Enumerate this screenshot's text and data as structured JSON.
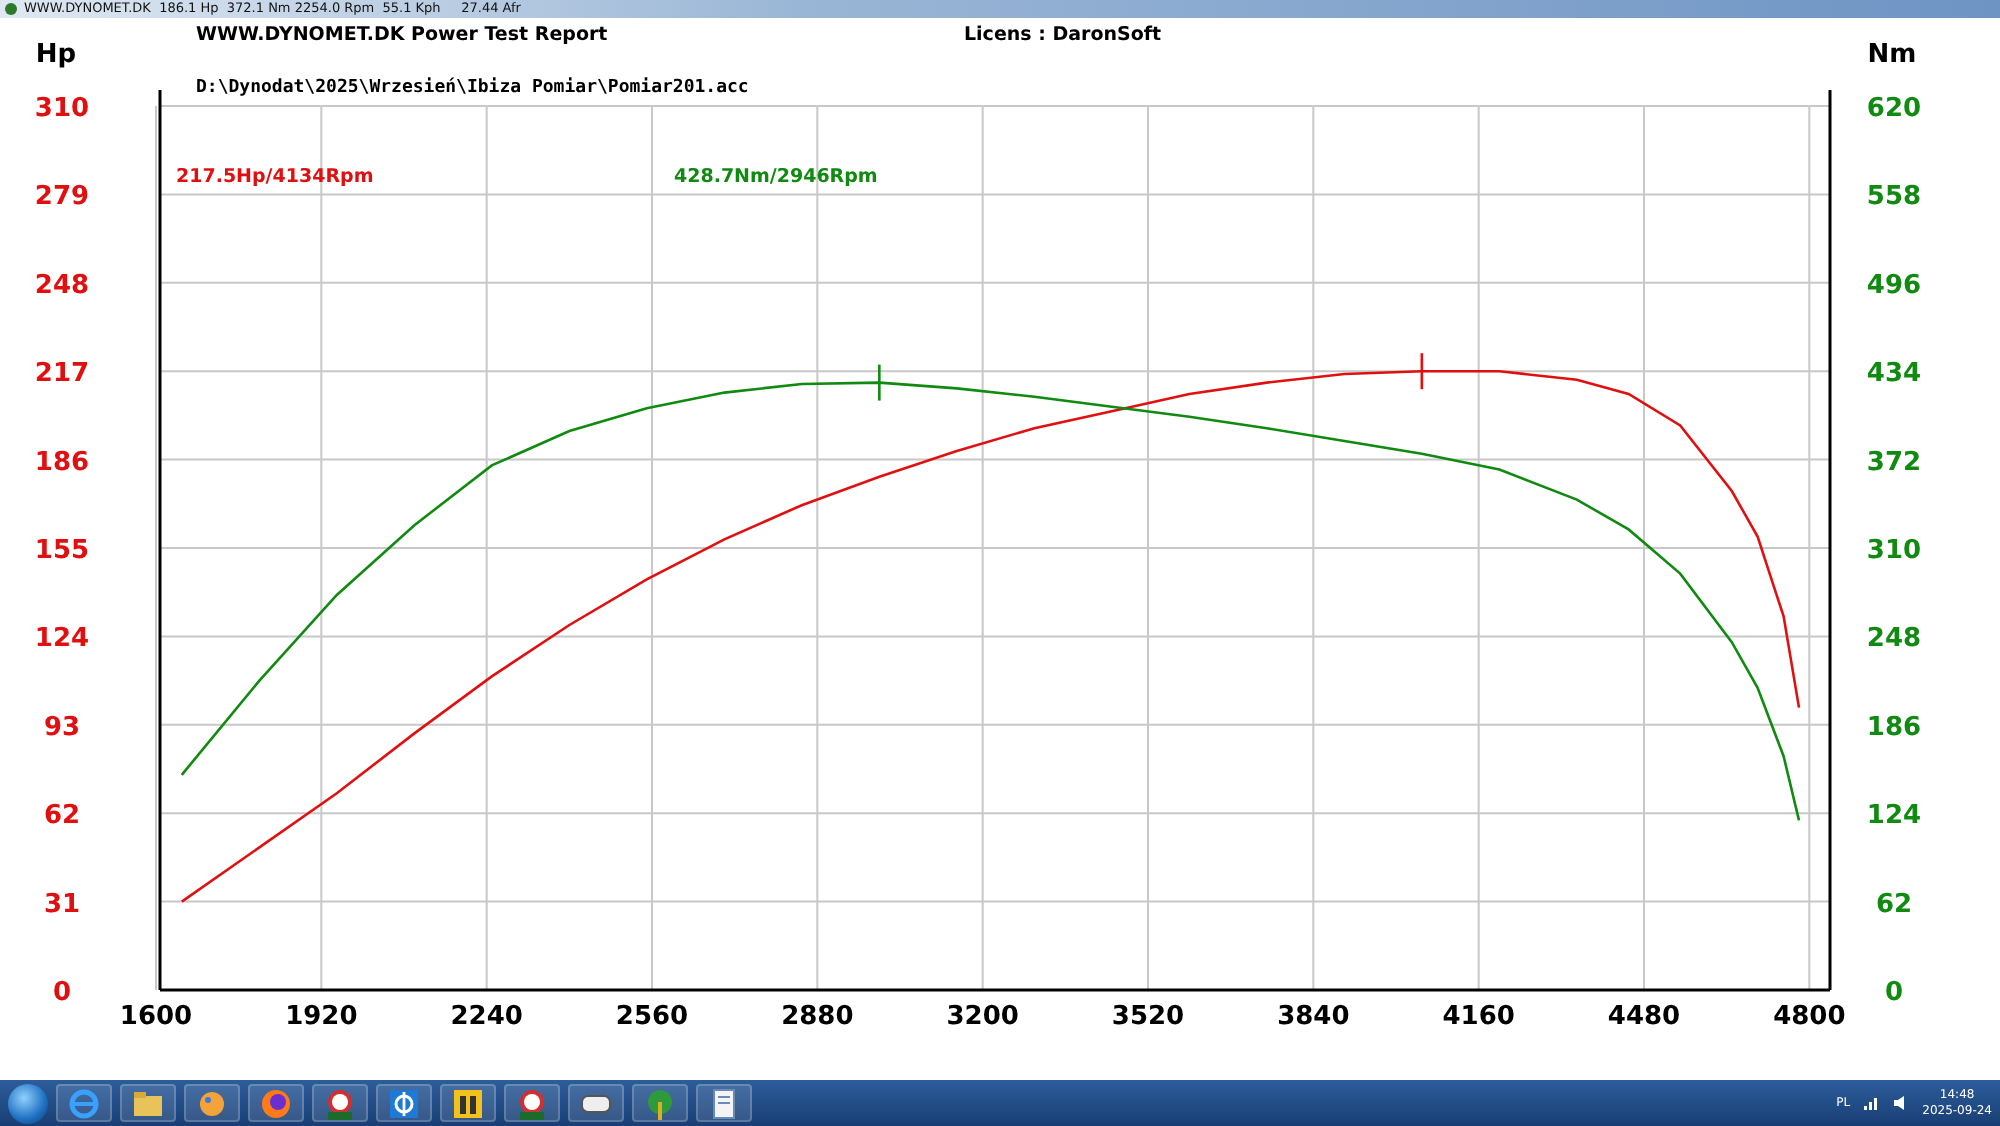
{
  "window": {
    "title": "WWW.DYNOMET.DK  186.1 Hp  372.1 Nm 2254.0 Rpm  55.1 Kph     27.44 Afr"
  },
  "report": {
    "header": "WWW.DYNOMET.DK  Power Test Report",
    "licence": "Licens :  DaronSoft",
    "file": "D:\\Dynodat\\2025\\Wrzesień\\Ibiza Pomiar\\Pomiar201.acc",
    "chart_data": {
      "type": "line",
      "ylabel": "Hp",
      "y2label": "Nm",
      "grid": true,
      "xlim": [
        1600,
        4840
      ],
      "ylim": [
        0,
        310
      ],
      "y2lim": [
        0,
        620
      ],
      "xticks": [
        1600,
        1920,
        2240,
        2560,
        2880,
        3200,
        3520,
        3840,
        4160,
        4480,
        4800
      ],
      "yticks": [
        0,
        31,
        62,
        93,
        124,
        155,
        186,
        217,
        248,
        279,
        310
      ],
      "y2ticks": [
        0,
        62,
        124,
        186,
        248,
        310,
        372,
        434,
        496,
        558,
        620
      ],
      "x": [
        1650,
        1800,
        1950,
        2100,
        2250,
        2400,
        2550,
        2700,
        2850,
        3000,
        3150,
        3300,
        3450,
        3600,
        3750,
        3900,
        4050,
        4200,
        4350,
        4450,
        4550,
        4650,
        4700,
        4750,
        4780
      ],
      "series": [
        {
          "color": "#e01010",
          "values": [
            31,
            50,
            69,
            90,
            110,
            128,
            144,
            158,
            170,
            180,
            189,
            197,
            203,
            209,
            213,
            216,
            217,
            217,
            214,
            209,
            198,
            175,
            159,
            131,
            99
          ]
        },
        {
          "axis": "y2",
          "color": "#108a10",
          "values": [
            151,
            217,
            277,
            326,
            368,
            392,
            408,
            419,
            425,
            426,
            422,
            416,
            409,
            402,
            394,
            385,
            376,
            365,
            344,
            323,
            292,
            244,
            212,
            164,
            119
          ]
        }
      ],
      "annotations": [
        "217.5Hp/4134Rpm",
        "428.7Nm/2946Rpm"
      ]
    }
  },
  "taskbar": {
    "apps": [
      {
        "kind": "ie"
      },
      {
        "kind": "folder"
      },
      {
        "kind": "paint"
      },
      {
        "kind": "firefox"
      },
      {
        "kind": "dyno"
      },
      {
        "kind": "phi"
      },
      {
        "kind": "at"
      },
      {
        "kind": "dyno"
      },
      {
        "kind": "vcds"
      },
      {
        "kind": "globe"
      },
      {
        "kind": "doc"
      }
    ],
    "language": "PL",
    "time": "14:48",
    "date": "2025-09-24"
  }
}
